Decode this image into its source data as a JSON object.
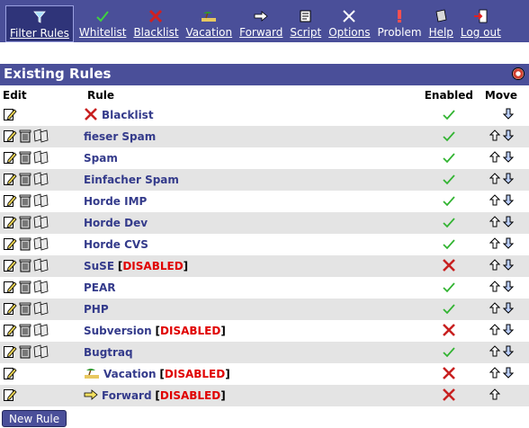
{
  "menu": {
    "items": [
      {
        "label": "Filter Rules",
        "icon": "filter-icon",
        "active": true
      },
      {
        "label": "Whitelist",
        "icon": "check-icon"
      },
      {
        "label": "Blacklist",
        "icon": "x-icon"
      },
      {
        "label": "Vacation",
        "icon": "vacation-icon"
      },
      {
        "label": "Forward",
        "icon": "forward-icon"
      },
      {
        "label": "Script",
        "icon": "script-icon"
      },
      {
        "label": "Options",
        "icon": "options-icon"
      },
      {
        "label": "Problem",
        "icon": "problem-icon"
      },
      {
        "label": "Help",
        "icon": "help-icon"
      },
      {
        "label": "Log out",
        "icon": "logout-icon"
      }
    ]
  },
  "panel": {
    "title": "Existing Rules"
  },
  "table": {
    "headers": {
      "edit": "Edit",
      "rule": "Rule",
      "enabled": "Enabled",
      "move": "Move"
    },
    "disabled_label": "DISABLED",
    "rows": [
      {
        "name": "Blacklist",
        "enabled": true
      },
      {
        "name": "fieser Spam",
        "enabled": true
      },
      {
        "name": "Spam",
        "enabled": true
      },
      {
        "name": "Einfacher Spam",
        "enabled": true
      },
      {
        "name": "Horde IMP",
        "enabled": true
      },
      {
        "name": "Horde Dev",
        "enabled": true
      },
      {
        "name": "Horde CVS",
        "enabled": true
      },
      {
        "name": "SuSE",
        "enabled": false
      },
      {
        "name": "PEAR",
        "enabled": true
      },
      {
        "name": "PHP",
        "enabled": true
      },
      {
        "name": "Subversion",
        "enabled": false
      },
      {
        "name": "Bugtraq",
        "enabled": true
      },
      {
        "name": "Vacation",
        "enabled": false
      },
      {
        "name": "Forward",
        "enabled": false
      }
    ]
  },
  "new_rule_button": "New Rule"
}
